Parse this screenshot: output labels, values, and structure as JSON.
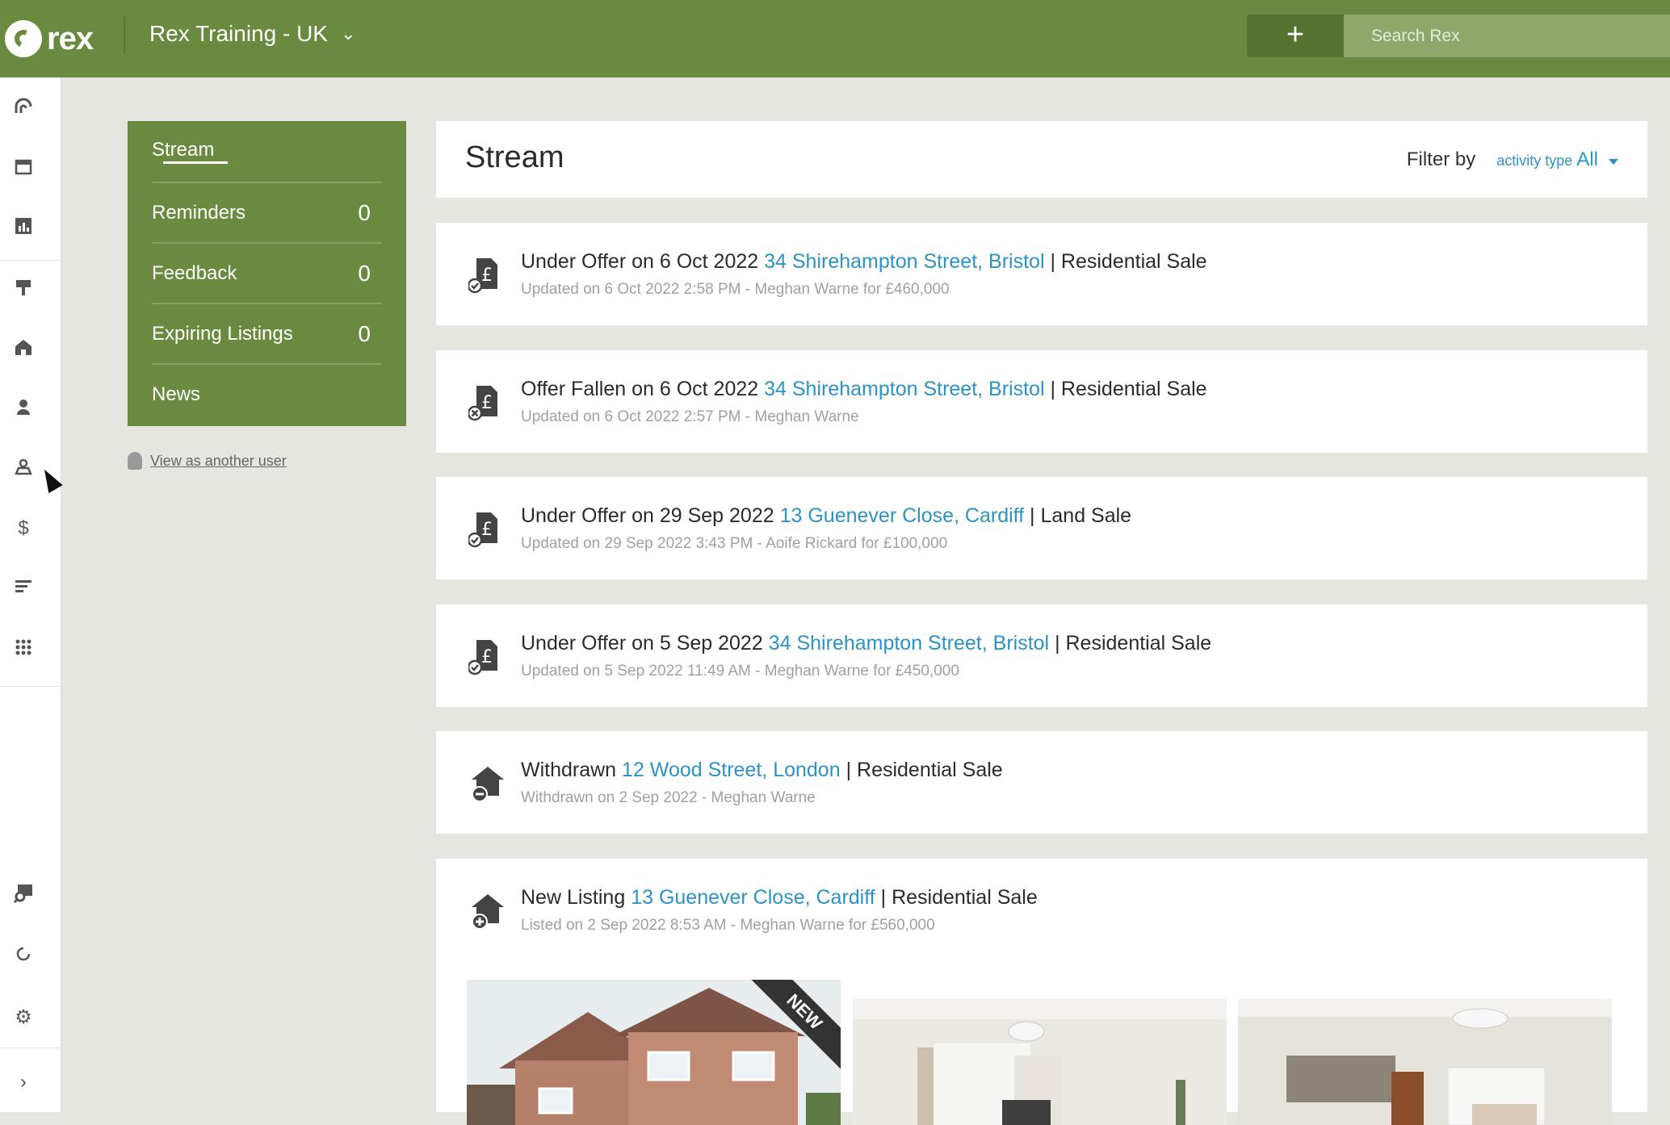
{
  "topbar": {
    "logo_text": "rex",
    "account_name": "Rex Training - UK",
    "add_label": "+",
    "search_placeholder": "Search Rex"
  },
  "colors": {
    "brand_green": "#6a8a3f",
    "link_blue": "#2b93c6"
  },
  "rail": {
    "icons": [
      "rex-home-icon",
      "calendar-icon",
      "reports-icon",
      "listings-sign-icon",
      "properties-icon",
      "contacts-icon",
      "leads-icon",
      "financials-icon",
      "lists-icon",
      "apps-grid-icon",
      "search-map-icon",
      "sync-icon",
      "settings-gear-icon",
      "expand-chevron-icon"
    ]
  },
  "sidenav": {
    "items": [
      {
        "label": "Stream",
        "count": ""
      },
      {
        "label": "Reminders",
        "count": "0"
      },
      {
        "label": "Feedback",
        "count": "0"
      },
      {
        "label": "Expiring Listings",
        "count": "0"
      },
      {
        "label": "News",
        "count": ""
      }
    ],
    "view_as_user": "View as another user"
  },
  "stream": {
    "title": "Stream",
    "filter_label": "Filter by",
    "filter_type": "activity type",
    "filter_value": "All",
    "cards": [
      {
        "prefix": "Under Offer on 6 Oct 2022",
        "address": "34 Shirehampton Street, Bristol",
        "suffix": "| Residential Sale",
        "detail": "Updated on 6 Oct 2022 2:58 PM - Meghan Warne for £460,000",
        "icon": "offer-accepted-icon"
      },
      {
        "prefix": "Offer Fallen on 6 Oct 2022",
        "address": "34 Shirehampton Street, Bristol",
        "suffix": "| Residential Sale",
        "detail": "Updated on 6 Oct 2022 2:57 PM - Meghan Warne",
        "icon": "offer-fallen-icon"
      },
      {
        "prefix": "Under Offer on 29 Sep 2022",
        "address": "13 Guenever Close, Cardiff",
        "suffix": "| Land Sale",
        "detail": "Updated on 29 Sep 2022 3:43 PM - Aoife Rickard for £100,000",
        "icon": "offer-accepted-icon"
      },
      {
        "prefix": "Under Offer on 5 Sep 2022",
        "address": "34 Shirehampton Street, Bristol",
        "suffix": "| Residential Sale",
        "detail": "Updated on 5 Sep 2022 11:49 AM - Meghan Warne for £450,000",
        "icon": "offer-accepted-icon"
      },
      {
        "prefix": "Withdrawn",
        "address": "12 Wood Street, London",
        "suffix": "| Residential Sale",
        "detail": "Withdrawn on 2 Sep 2022 - Meghan Warne",
        "icon": "listing-withdrawn-icon"
      },
      {
        "prefix": "New Listing",
        "address": "13 Guenever Close, Cardiff",
        "suffix": "| Residential Sale",
        "detail": "Listed on 2 Sep 2022 8:53 AM - Meghan Warne for £560,000",
        "icon": "new-listing-icon"
      }
    ],
    "new_badge": "NEW"
  }
}
